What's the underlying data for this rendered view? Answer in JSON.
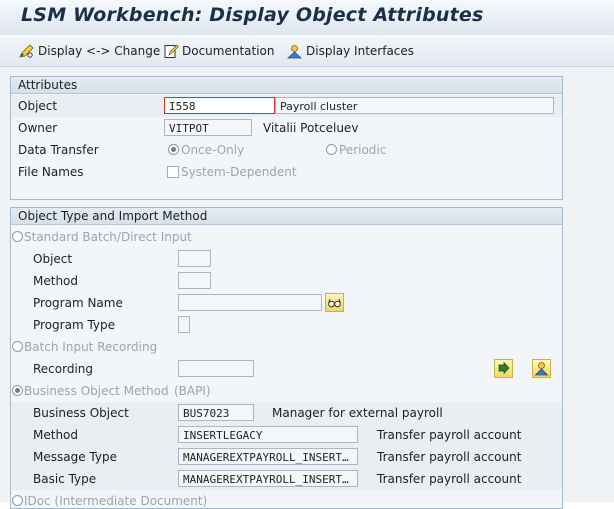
{
  "window": {
    "title": "LSM Workbench: Display Object Attributes"
  },
  "toolbar": {
    "display_change": "Display <-> Change",
    "documentation": "Documentation",
    "display_interfaces": "Display Interfaces"
  },
  "attributes": {
    "title": "Attributes",
    "object_label": "Object",
    "object_value": "I558",
    "object_desc": "Payroll cluster",
    "owner_label": "Owner",
    "owner_value": "VITPOT",
    "owner_name": "Vitalii Potceluev",
    "transfer_label": "Data Transfer",
    "transfer_once": "Once-Only",
    "transfer_periodic": "Periodic",
    "filenames_label": "File Names",
    "system_dependent": "System-Dependent"
  },
  "import_method": {
    "title": "Object Type and Import Method",
    "standard_batch": "Standard Batch/Direct Input",
    "object_label": "Object",
    "method_label": "Method",
    "program_name_label": "Program Name",
    "program_type_label": "Program Type",
    "batch_input_recording": "Batch Input Recording",
    "recording_label": "Recording",
    "bapi": "Business Object Method",
    "bapi_suffix": "(BAPI)",
    "business_object_label": "Business Object",
    "business_object_value": "BUS7023",
    "business_object_desc": "Manager for external payroll",
    "bapi_method_label": "Method",
    "bapi_method_value": "INSERTLEGACY",
    "bapi_method_desc": "Transfer payroll account",
    "message_type_label": "Message Type",
    "message_type_value": "MANAGEREXTPAYROLL_INSERT…",
    "message_type_desc": "Transfer payroll account",
    "basic_type_label": "Basic Type",
    "basic_type_value": "MANAGEREXTPAYROLL_INSERT…",
    "basic_type_desc": "Transfer payroll account",
    "idoc": "IDoc (Intermediate Document)"
  }
}
